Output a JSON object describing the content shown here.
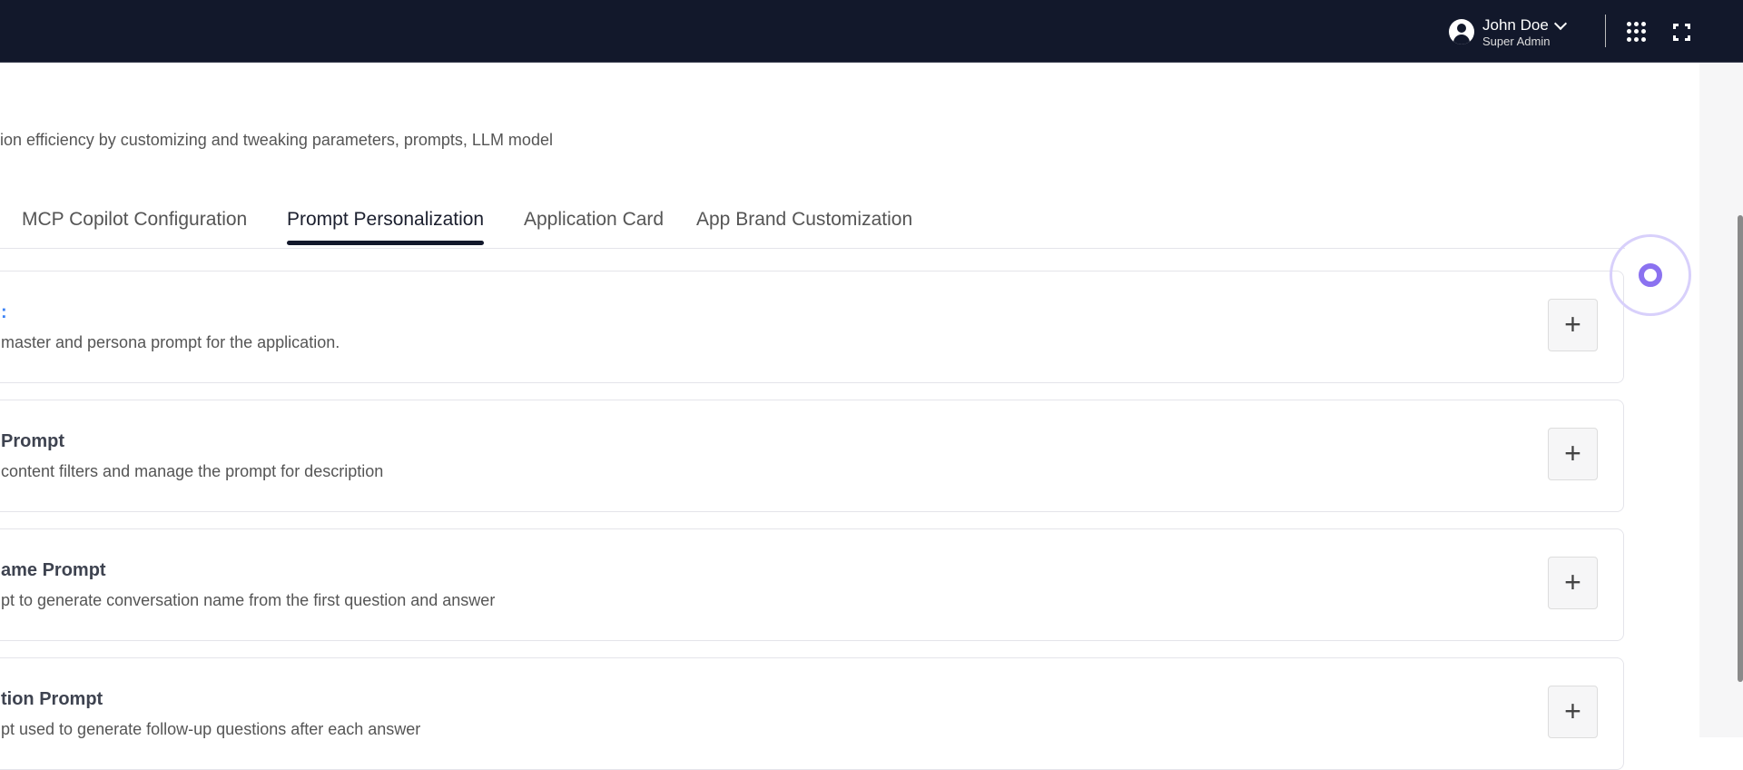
{
  "header": {
    "user_name": "John Doe",
    "user_role": "Super Admin"
  },
  "page": {
    "subtitle": "ion efficiency by customizing and tweaking parameters, prompts, LLM model"
  },
  "tabs": [
    {
      "label": "MCP Copilot Configuration"
    },
    {
      "label": "Prompt Personalization",
      "active": true
    },
    {
      "label": "Application Card"
    },
    {
      "label": "App Brand Customization"
    }
  ],
  "cards": [
    {
      "title": ":",
      "description": "master and persona prompt for the application."
    },
    {
      "title": "Prompt",
      "description": "content filters and manage the prompt for description"
    },
    {
      "title": "ame Prompt",
      "description": "pt to generate conversation name from the first question and answer"
    },
    {
      "title": "tion Prompt",
      "description": "pt used to generate follow-up questions after each answer"
    }
  ],
  "colors": {
    "header_bg": "#12182b",
    "accent": "#8b72f0"
  }
}
